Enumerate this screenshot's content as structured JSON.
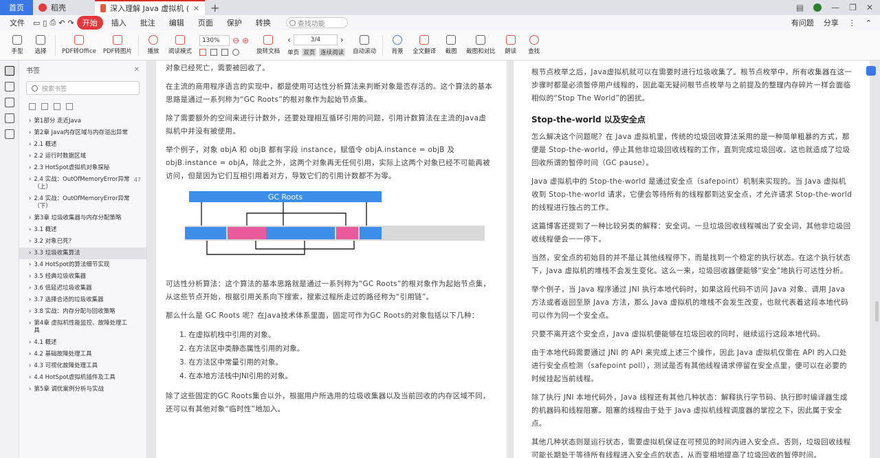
{
  "tabs": {
    "home": "首页",
    "tab1": "稻壳",
    "tab2": "深入理解 Java 虚拟机 (第3版).pdf"
  },
  "menu": {
    "items": [
      "文件",
      "开始",
      "插入",
      "批注",
      "编辑",
      "页面",
      "保护",
      "转换"
    ],
    "active_index": 1,
    "search_placeholder": "查找功能",
    "right1": "有问题",
    "right2": "分享"
  },
  "toolbar": {
    "buttons": [
      "手型",
      "选择",
      "PDF转Office",
      "PDF转图片",
      "播放",
      "阅读模式",
      "旋转文档",
      "单页",
      "双页",
      "连续阅读",
      "自动滚动",
      "背景",
      "全文翻译",
      "截图",
      "截图和对比",
      "朗读",
      "查找"
    ],
    "zoom": "130%",
    "page": "3/4"
  },
  "sidebar": {
    "title": "书签",
    "search_placeholder": "搜索书签",
    "items": [
      {
        "label": "第1部分 走近Java",
        "page": ""
      },
      {
        "label": "第2章 Java内存区域与内存溢出异常",
        "page": ""
      },
      {
        "label": "2.1 概述",
        "page": ""
      },
      {
        "label": "2.2 运行时数据区域",
        "page": ""
      },
      {
        "label": "2.3 HotSpot虚拟机对象探秘",
        "page": ""
      },
      {
        "label": "2.4 实战：OutOfMemoryError异常（上）",
        "page": "47"
      },
      {
        "label": "2.4 实战：OutOfMemoryError异常（下）",
        "page": ""
      },
      {
        "label": "第3章 垃圾收集器与内存分配策略",
        "page": ""
      },
      {
        "label": "3.1 概述",
        "page": ""
      },
      {
        "label": "3.2 对象已死？",
        "page": ""
      },
      {
        "label": "3.3 垃圾收集算法",
        "page": ""
      },
      {
        "label": "3.4 HotSpot的算法细节实现",
        "page": ""
      },
      {
        "label": "3.5 经典垃圾收集器",
        "page": ""
      },
      {
        "label": "3.6 低延迟垃圾收集器",
        "page": ""
      },
      {
        "label": "3.7 选择合适的垃圾收集器",
        "page": ""
      },
      {
        "label": "3.8 实战：内存分配与回收策略",
        "page": ""
      },
      {
        "label": "第4章 虚拟机性能监控、故障处理工具",
        "page": ""
      },
      {
        "label": "4.1 概述",
        "page": ""
      },
      {
        "label": "4.2 基础故障处理工具",
        "page": ""
      },
      {
        "label": "4.3 可视化故障处理工具",
        "page": ""
      },
      {
        "label": "4.4 HotSpot虚拟机插件及工具",
        "page": ""
      },
      {
        "label": "第5章 调优案例分析与实战",
        "page": ""
      }
    ],
    "active_index": 10
  },
  "left_page": {
    "p0": "对象已经死亡，需要被回收了。",
    "p1": "在主流的商用程序语言的实现中，都是使用可达性分析算法来判断对象是否存活的。这个算法的基本思路是通过一系列称为“GC Roots”的根对象作为起始节点集。",
    "p2": "除了需要额外的空间来进行计数外，还要处理相互循环引用的问题，引用计数算法在主流的Java虚拟机中并没有被使用。",
    "p3": "举个例子，对象 objA 和 objB 都有字段 instance，赋值令 objA.instance = objB 及 objB.instance = objA，除此之外，这两个对象再无任何引用，实际上这两个对象已经不可能再被访问，但是因为它们互相引用着对方，导致它们的引用计数都不为零。",
    "diagram_title": "GC Roots",
    "p4": "可达性分析算法：这个算法的基本思路就是通过一系列称为“GC Roots”的根对象作为起始节点集，从这些节点开始，根据引用关系向下搜索，搜索过程所走过的路径称为“引用链”。",
    "p5": "那么什么是 GC Roots 呢？在Java技术体系里面，固定可作为GC Roots的对象包括以下几种：",
    "list": [
      "在虚拟机栈中引用的对象。",
      "在方法区中类静态属性引用的对象。",
      "在方法区中常量引用的对象。",
      "在本地方法栈中JNI引用的对象。"
    ],
    "p6": "除了这些固定的GC Roots集合以外，根据用户所选用的垃圾收集器以及当前回收的内存区域不同，还可以有其他对象“临时性”地加入。"
  },
  "right_page": {
    "p0": "根节点枚举之后，Java虚拟机就可以在需要时进行垃圾收集了。根节点枚举中，所有收集器在这一步骤时都是必须暂停用户线程的，因此毫无疑问根节点枚举与之前提及的整理内存碎片一样会面临相似的“Stop The World”的困扰。",
    "h_stw": "Stop-the-world 以及安全点",
    "p1": "怎么解决这个问题呢？在 Java 虚拟机里，传统的垃圾回收算法采用的是一种简单粗暴的方式，那便是 Stop-the-world，停止其他非垃圾回收线程的工作，直到完成垃圾回收。这也就造成了垃圾回收所谓的暂停时间（GC pause）。",
    "p2": "Java 虚拟机中的 Stop-the-world 是通过安全点（safepoint）机制来实现的。当 Java 虚拟机收到 Stop-the-world 请求，它便会等待所有的线程都到达安全点，才允许请求 Stop-the-world 的线程进行独占的工作。",
    "p3": "这篇博客还提到了一种比较另类的解释：安全词。一旦垃圾回收线程喊出了安全词，其他非垃圾回收线程便会一一停下。",
    "p4": "当然，安全点的初始目的并不是让其他线程停下，而是找到一个稳定的执行状态。在这个执行状态下，Java 虚拟机的堆栈不会发生变化。这么一来，垃圾回收器便能够“安全”地执行可达性分析。",
    "p5": "举个例子，当 Java 程序通过 JNI 执行本地代码时，如果这段代码不访问 Java 对象、调用 Java 方法或者返回至原 Java 方法，那么 Java 虚拟机的堆栈不会发生改变，也就代表着这段本地代码可以作为同一个安全点。",
    "p6": "只要不离开这个安全点，Java 虚拟机便能够在垃圾回收的同时，继续运行这段本地代码。",
    "p7": "由于本地代码需要通过 JNI 的 API 来完成上述三个操作，因此 Java 虚拟机仅需在 API 的入口处进行安全点检测（safepoint poll），测试是否有其他线程请求停留在安全点里，便可以在必要的时候挂起当前线程。",
    "p8": "除了执行 JNI 本地代码外，Java 线程还有其他几种状态：解释执行字节码、执行即时编译器生成的机器码和线程阻塞。阻塞的线程由于处于 Java 虚拟机线程调度器的掌控之下，因此属于安全点。",
    "p9": "其他几种状态则是运行状态，需要虚拟机保证在可预见的时间内进入安全点。否则，垃圾回收线程可能长期处于等待所有线程进入安全点的状态，从而变相地提高了垃圾回收的暂停时间。"
  }
}
